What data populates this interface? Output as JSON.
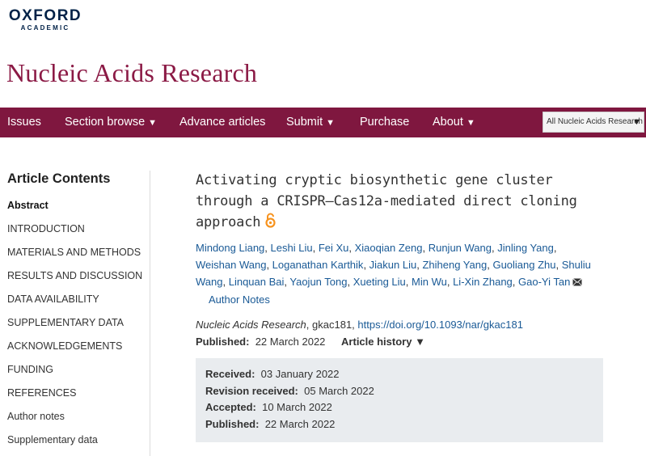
{
  "brand": {
    "name": "OXFORD",
    "subname": "ACADEMIC"
  },
  "journal": {
    "title": "Nucleic Acids Research"
  },
  "nav": {
    "items": [
      {
        "label": "Issues",
        "has_caret": false
      },
      {
        "label": "Section browse",
        "has_caret": true
      },
      {
        "label": "Advance articles",
        "has_caret": false
      },
      {
        "label": "Submit",
        "has_caret": true
      },
      {
        "label": "Purchase",
        "has_caret": false
      },
      {
        "label": "About",
        "has_caret": true
      }
    ],
    "caret": "▼",
    "search_scope": "All Nucleic Acids Research"
  },
  "sidebar": {
    "title": "Article Contents",
    "items": [
      "Abstract",
      "INTRODUCTION",
      "MATERIALS AND METHODS",
      "RESULTS AND DISCUSSION",
      "DATA AVAILABILITY",
      "SUPPLEMENTARY DATA",
      "ACKNOWLEDGEMENTS",
      "FUNDING",
      "REFERENCES",
      "Author notes",
      "Supplementary data"
    ],
    "active_index": 0
  },
  "article": {
    "title_lines": [
      "Activating cryptic biosynthetic gene cluster",
      "through a CRISPR–Cas12a-mediated direct cloning",
      "approach"
    ],
    "authors": [
      "Mindong Liang",
      "Leshi Liu",
      "Fei Xu",
      "Xiaoqian Zeng",
      "Runjun Wang",
      "Jinling Yang",
      "Weishan Wang",
      "Loganathan Karthik",
      "Jiakun Liu",
      "Zhiheng Yang",
      "Guoliang Zhu",
      "Shuliu Wang",
      "Linquan Bai",
      "Yaojun Tong",
      "Xueting Liu",
      "Min Wu",
      "Li-Xin Zhang",
      "Gao-Yi Tan"
    ],
    "author_notes_label": "Author Notes",
    "citation_journal": "Nucleic Acids Research",
    "citation_id": ", gkac181, ",
    "doi": "https://doi.org/10.1093/nar/gkac181",
    "published_label": "Published:",
    "published_date": "22 March 2022",
    "history_label": "Article history ▼",
    "history": [
      {
        "label": "Received:",
        "date": "03 January 2022"
      },
      {
        "label": "Revision received:",
        "date": "05 March 2022"
      },
      {
        "label": "Accepted:",
        "date": "10 March 2022"
      },
      {
        "label": "Published:",
        "date": "22 March 2022"
      }
    ]
  },
  "colors": {
    "brand_navy": "#002147",
    "journal_maroon": "#8b1a45",
    "nav_bg": "#7f173f",
    "link_blue": "#1a5a96",
    "history_bg": "#e9ecef"
  }
}
